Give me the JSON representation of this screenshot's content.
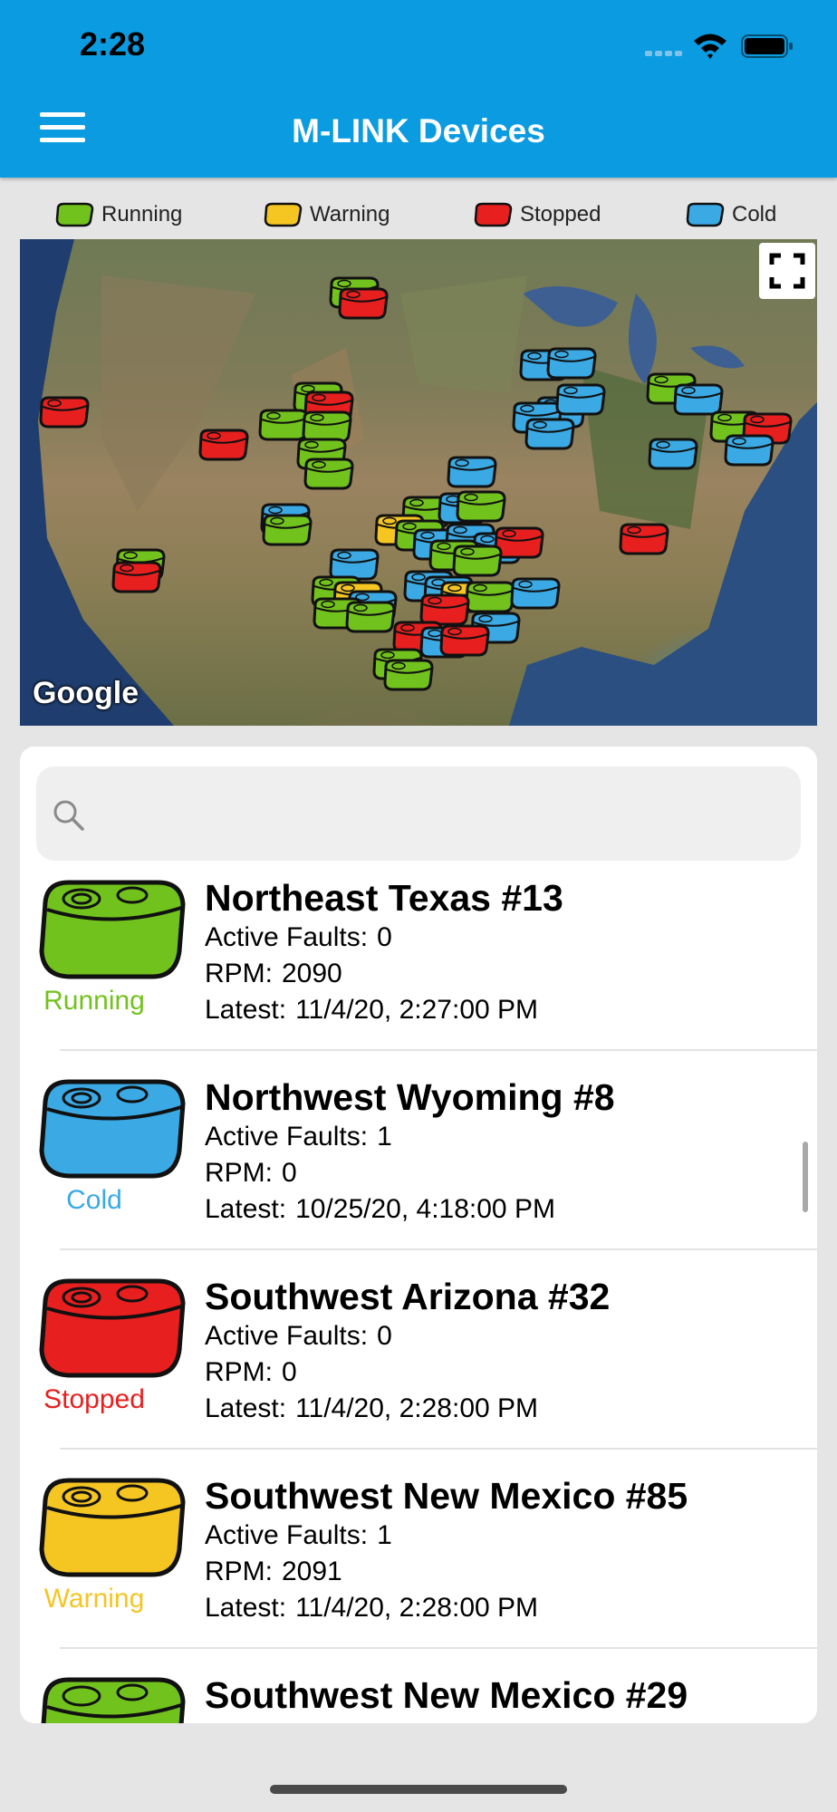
{
  "status_bar": {
    "time": "2:28"
  },
  "header": {
    "title": "M-LINK Devices",
    "menu_icon": "hamburger-menu-icon"
  },
  "legend": [
    {
      "label": "Running",
      "color": "#72c21d"
    },
    {
      "label": "Warning",
      "color": "#f5c522"
    },
    {
      "label": "Stopped",
      "color": "#e81f1f"
    },
    {
      "label": "Cold",
      "color": "#3aa9e4"
    }
  ],
  "map": {
    "attribution": "Google",
    "fullscreen_icon": "fullscreen-icon"
  },
  "search": {
    "placeholder": "",
    "value": ""
  },
  "devices": [
    {
      "name": "Northeast Texas #13",
      "status": "Running",
      "status_color": "#72c21d",
      "faults_label": "Active Faults:",
      "faults": "0",
      "rpm_label": "RPM:",
      "rpm": "2090",
      "latest_label": "Latest:",
      "latest": "11/4/20, 2:27:00 PM"
    },
    {
      "name": "Northwest Wyoming #8",
      "status": "Cold",
      "status_color": "#3aa9e4",
      "faults_label": "Active Faults:",
      "faults": "1",
      "rpm_label": "RPM:",
      "rpm": "0",
      "latest_label": "Latest:",
      "latest": "10/25/20, 4:18:00 PM"
    },
    {
      "name": "Southwest Arizona #32",
      "status": "Stopped",
      "status_color": "#e81f1f",
      "faults_label": "Active Faults:",
      "faults": "0",
      "rpm_label": "RPM:",
      "rpm": "0",
      "latest_label": "Latest:",
      "latest": "11/4/20, 2:28:00 PM"
    },
    {
      "name": "Southwest New Mexico #85",
      "status": "Warning",
      "status_color": "#f5c522",
      "faults_label": "Active Faults:",
      "faults": "1",
      "rpm_label": "RPM:",
      "rpm": "2091",
      "latest_label": "Latest:",
      "latest": "11/4/20, 2:28:00 PM"
    },
    {
      "name": "Southwest New Mexico #29",
      "status": "Running",
      "status_color": "#72c21d"
    }
  ]
}
